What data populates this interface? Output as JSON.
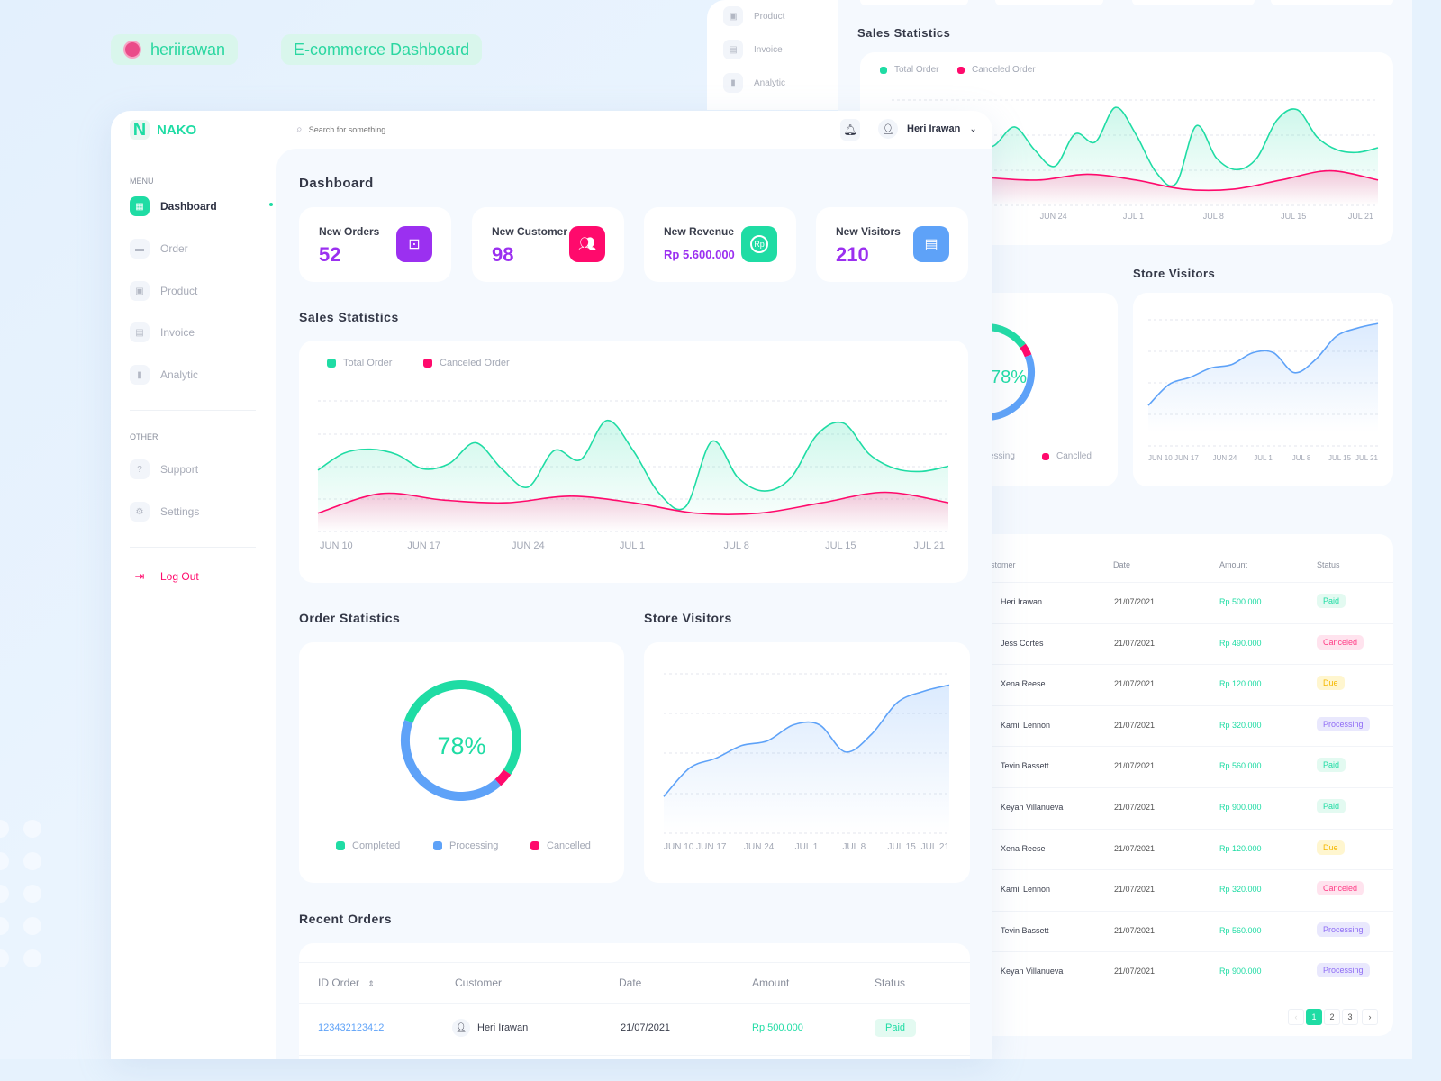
{
  "brand_badges": {
    "author": "heriirawan",
    "title": "E-commerce Dashboard"
  },
  "app": {
    "logo_letter": "N",
    "name": "NAKO"
  },
  "search": {
    "placeholder": "Search for something..."
  },
  "user": {
    "name": "Heri Irawan"
  },
  "sidebar": {
    "menu_heading": "MENU",
    "items": [
      {
        "label": "Dashboard",
        "icon": "grid-icon",
        "active": true
      },
      {
        "label": "Order",
        "icon": "card-icon"
      },
      {
        "label": "Product",
        "icon": "box-icon"
      },
      {
        "label": "Invoice",
        "icon": "document-icon"
      },
      {
        "label": "Analytic",
        "icon": "bar-chart-icon"
      }
    ],
    "other_heading": "OTHER",
    "other_items": [
      {
        "label": "Support",
        "icon": "help-icon"
      },
      {
        "label": "Settings",
        "icon": "gear-icon"
      }
    ],
    "logout": "Log Out"
  },
  "page_title": "Dashboard",
  "stats": [
    {
      "label": "New Orders",
      "value": "52",
      "icon": "shopping-bag-icon",
      "color": "#9b30f0"
    },
    {
      "label": "New Customer",
      "value": "98",
      "icon": "users-icon",
      "color": "#ff0a6c"
    },
    {
      "label": "New Revenue",
      "value": "Rp 5.600.000",
      "icon": "rupiah-icon",
      "color": "#1fdca4"
    },
    {
      "label": "New Visitors",
      "value": "210",
      "icon": "id-badge-icon",
      "color": "#5ea2f8"
    }
  ],
  "sales": {
    "title": "Sales Statistics",
    "legend": [
      {
        "label": "Total Order",
        "color": "#1fdca4"
      },
      {
        "label": "Canceled Order",
        "color": "#ff0a6c"
      }
    ]
  },
  "order_stats": {
    "title": "Order Statistics",
    "center_label": "78%",
    "legend": [
      {
        "label": "Completed",
        "color": "#1fdca4"
      },
      {
        "label": "Processing",
        "color": "#5ea2f8"
      },
      {
        "label": "Cancelled",
        "color": "#ff0a6c"
      }
    ],
    "back_legend": [
      "essing",
      "Canclled"
    ]
  },
  "visitors": {
    "title": "Store Visitors"
  },
  "chart_data": [
    {
      "type": "area",
      "title": "Sales Statistics",
      "categories": [
        "JUN 10",
        "JUN 17",
        "JUN 24",
        "JUL 1",
        "JUL 8",
        "JUL 15",
        "JUL 21"
      ],
      "series": [
        {
          "name": "Total Order",
          "values": [
            47,
            60,
            63,
            59,
            48,
            52,
            68,
            48,
            34,
            62,
            55,
            85,
            62,
            29,
            19,
            69,
            41,
            31,
            41,
            74,
            83,
            59,
            48,
            46,
            50
          ]
        },
        {
          "name": "Canceled Order",
          "values": [
            14,
            29,
            24,
            22,
            27,
            22,
            14,
            14,
            22,
            30,
            22
          ]
        }
      ],
      "ylim": [
        0,
        100
      ],
      "grid": true,
      "legend": "top-left"
    },
    {
      "type": "donut",
      "title": "Order Statistics",
      "center": "78%",
      "slices": [
        {
          "name": "Completed",
          "value": 54
        },
        {
          "name": "Cancelled",
          "value": 4
        },
        {
          "name": "Processing",
          "value": 42
        }
      ],
      "legend": "bottom"
    },
    {
      "type": "area",
      "title": "Store Visitors",
      "categories": [
        "JUN 10",
        "JUN 17",
        "JUN 24",
        "JUL 1",
        "JUL 8",
        "JUL 15",
        "JUL 21"
      ],
      "series": [
        {
          "values": [
            23,
            41,
            47,
            55,
            58,
            68,
            68,
            51,
            62,
            82,
            89,
            93
          ]
        }
      ],
      "ylim": [
        0,
        100
      ],
      "grid": true
    }
  ],
  "recent_orders": {
    "title": "Recent Orders",
    "columns": [
      "ID Order",
      "Customer",
      "Date",
      "Amount",
      "Status"
    ],
    "rows": [
      {
        "id": "123432123412",
        "customer": "Heri Irawan",
        "date": "21/07/2021",
        "amount": "Rp 500.000",
        "status": "Paid"
      }
    ]
  },
  "back_table": {
    "columns": [
      "stomer",
      "Date",
      "Amount",
      "Status"
    ],
    "rows": [
      {
        "customer": "Heri Irawan",
        "date": "21/07/2021",
        "amount": "Rp 500.000",
        "status": "Paid"
      },
      {
        "customer": "Jess Cortes",
        "date": "21/07/2021",
        "amount": "Rp 490.000",
        "status": "Canceled"
      },
      {
        "customer": "Xena Reese",
        "date": "21/07/2021",
        "amount": "Rp 120.000",
        "status": "Due"
      },
      {
        "customer": "Kamil Lennon",
        "date": "21/07/2021",
        "amount": "Rp 320.000",
        "status": "Processing"
      },
      {
        "customer": "Tevin Bassett",
        "date": "21/07/2021",
        "amount": "Rp 560.000",
        "status": "Paid"
      },
      {
        "customer": "Keyan Villanueva",
        "date": "21/07/2021",
        "amount": "Rp 900.000",
        "status": "Paid"
      },
      {
        "customer": "Xena Reese",
        "date": "21/07/2021",
        "amount": "Rp 120.000",
        "status": "Due"
      },
      {
        "customer": "Kamil Lennon",
        "date": "21/07/2021",
        "amount": "Rp 320.000",
        "status": "Canceled"
      },
      {
        "customer": "Tevin Bassett",
        "date": "21/07/2021",
        "amount": "Rp 560.000",
        "status": "Processing"
      },
      {
        "customer": "Keyan Villanueva",
        "date": "21/07/2021",
        "amount": "Rp 900.000",
        "status": "Processing"
      }
    ],
    "pagination": {
      "prev": "‹",
      "pages": [
        "1",
        "2",
        "3"
      ],
      "current": "1",
      "next": "›"
    }
  },
  "status_colors": {
    "Paid": {
      "bg": "#e3faf1",
      "fg": "#1fdca4"
    },
    "Canceled": {
      "bg": "#ffe3ee",
      "fg": "#ff3c86"
    },
    "Due": {
      "bg": "#fff6cf",
      "fg": "#f5b800"
    },
    "Processing": {
      "bg": "#e9e8fd",
      "fg": "#8f6cf5"
    }
  }
}
